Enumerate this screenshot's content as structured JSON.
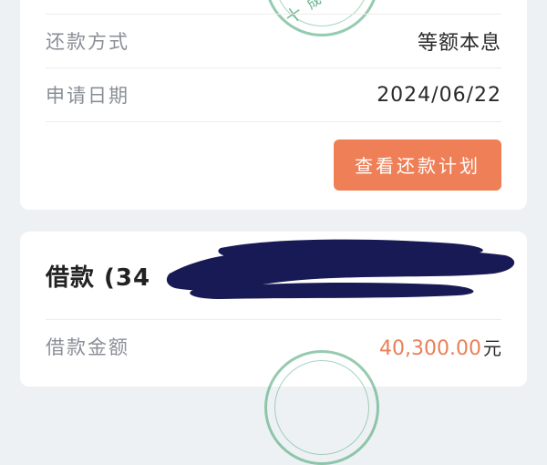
{
  "repayment_card": {
    "repayment_method_label": "还款方式",
    "repayment_method_value": "等额本息",
    "application_date_label": "申请日期",
    "application_date_value": "2024/06/22",
    "view_plan_button": "查看还款计划",
    "stamp_text": "成功"
  },
  "loan_card": {
    "title": "借款 (34",
    "amount_label": "借款金额",
    "amount_value": "40,300.00",
    "amount_unit": "元"
  },
  "colors": {
    "accent": "#ef7f57",
    "amount": "#e9805a",
    "stamp": "#3ea06e",
    "redaction": "#181a55"
  }
}
